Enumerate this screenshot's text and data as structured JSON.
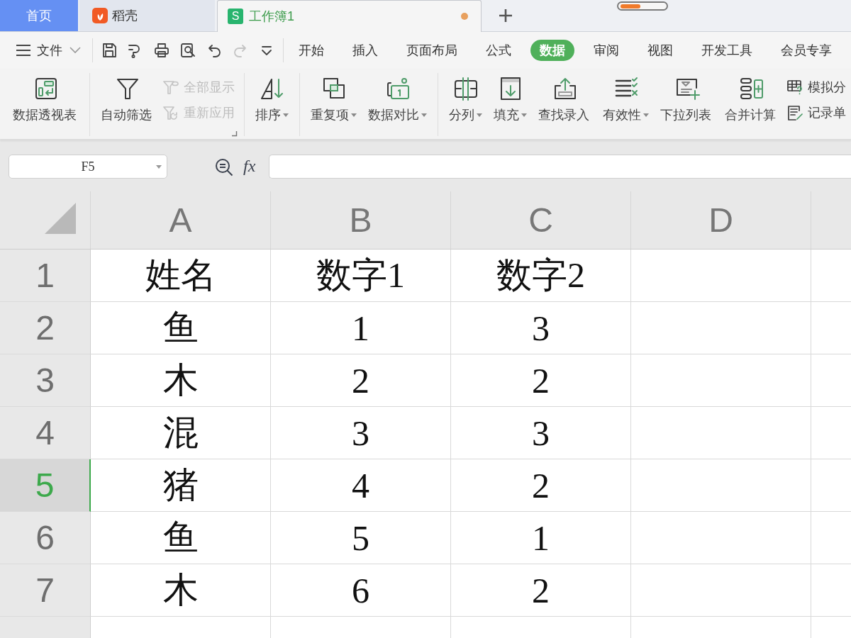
{
  "document_tabs": [
    {
      "kind": "home",
      "label": "首页",
      "selected": false,
      "modified": false
    },
    {
      "kind": "docer",
      "label": "稻壳",
      "selected": false,
      "modified": false
    },
    {
      "kind": "sheet",
      "label": "工作簿1",
      "logo_letter": "S",
      "selected": true,
      "modified": true
    }
  ],
  "progress": {
    "level": 0.45
  },
  "file_menu": {
    "label": "文件"
  },
  "quick_access": [
    {
      "disabled": false
    },
    {
      "disabled": false
    },
    {
      "disabled": false
    },
    {
      "disabled": false
    },
    {
      "disabled": false
    },
    {
      "disabled": true
    },
    {
      "disabled": false
    }
  ],
  "ribbon_tabs": [
    {
      "label": "开始",
      "selected": false
    },
    {
      "label": "插入",
      "selected": false
    },
    {
      "label": "页面布局",
      "selected": false
    },
    {
      "label": "公式",
      "selected": false
    },
    {
      "label": "数据",
      "selected": true
    },
    {
      "label": "审阅",
      "selected": false
    },
    {
      "label": "视图",
      "selected": false
    },
    {
      "label": "开发工具",
      "selected": false
    },
    {
      "label": "会员专享",
      "selected": false
    }
  ],
  "ribbon_groups": [
    {
      "items": [
        {
          "kind": "large",
          "label": "数据透视表",
          "dropdown": false,
          "disabled": false
        }
      ]
    },
    {
      "items": [
        {
          "kind": "large",
          "label": "自动筛选",
          "dropdown": false,
          "disabled": false
        },
        {
          "kind": "small",
          "label": "全部显示",
          "dropdown": false,
          "disabled": true
        },
        {
          "kind": "small",
          "label": "重新应用",
          "dropdown": false,
          "disabled": true
        },
        {
          "kind": "launcher"
        }
      ]
    },
    {
      "items": [
        {
          "kind": "large",
          "label": "排序",
          "dropdown": true,
          "disabled": false
        }
      ]
    },
    {
      "items": [
        {
          "kind": "large",
          "label": "重复项",
          "dropdown": true,
          "disabled": false
        },
        {
          "kind": "large",
          "label": "数据对比",
          "dropdown": true,
          "disabled": false
        }
      ]
    },
    {
      "items": [
        {
          "kind": "large",
          "label": "分列",
          "dropdown": true,
          "disabled": false
        },
        {
          "kind": "large",
          "label": "填充",
          "dropdown": true,
          "disabled": false
        },
        {
          "kind": "large",
          "label": "查找录入",
          "dropdown": false,
          "disabled": false
        },
        {
          "kind": "large",
          "label": "有效性",
          "dropdown": true,
          "disabled": false
        },
        {
          "kind": "large",
          "label": "下拉列表",
          "dropdown": false,
          "disabled": false
        },
        {
          "kind": "large",
          "label": "合并计算",
          "dropdown": false,
          "disabled": false
        },
        {
          "kind": "small",
          "label": "模拟分",
          "dropdown": false,
          "disabled": false
        },
        {
          "kind": "small",
          "label": "记录单",
          "dropdown": false,
          "disabled": false
        }
      ]
    }
  ],
  "name_box": {
    "value": "F5"
  },
  "formula_bar": {
    "function_label": "fx"
  },
  "sheet": {
    "columns": [
      {
        "label": "A"
      },
      {
        "label": "B"
      },
      {
        "label": "C"
      },
      {
        "label": "D"
      }
    ],
    "rows": [
      {
        "label": "1",
        "selected": false,
        "cells": [
          "姓名",
          "数字1",
          "数字2"
        ]
      },
      {
        "label": "2",
        "selected": false,
        "cells": [
          "鱼",
          "1",
          "3"
        ]
      },
      {
        "label": "3",
        "selected": false,
        "cells": [
          "木",
          "2",
          "2"
        ]
      },
      {
        "label": "4",
        "selected": false,
        "cells": [
          "混",
          "3",
          "3"
        ]
      },
      {
        "label": "5",
        "selected": true,
        "cells": [
          "猪",
          "4",
          "2"
        ]
      },
      {
        "label": "6",
        "selected": false,
        "cells": [
          "鱼",
          "5",
          "1"
        ]
      },
      {
        "label": "7",
        "selected": false,
        "cells": [
          "木",
          "6",
          "2"
        ]
      }
    ]
  }
}
